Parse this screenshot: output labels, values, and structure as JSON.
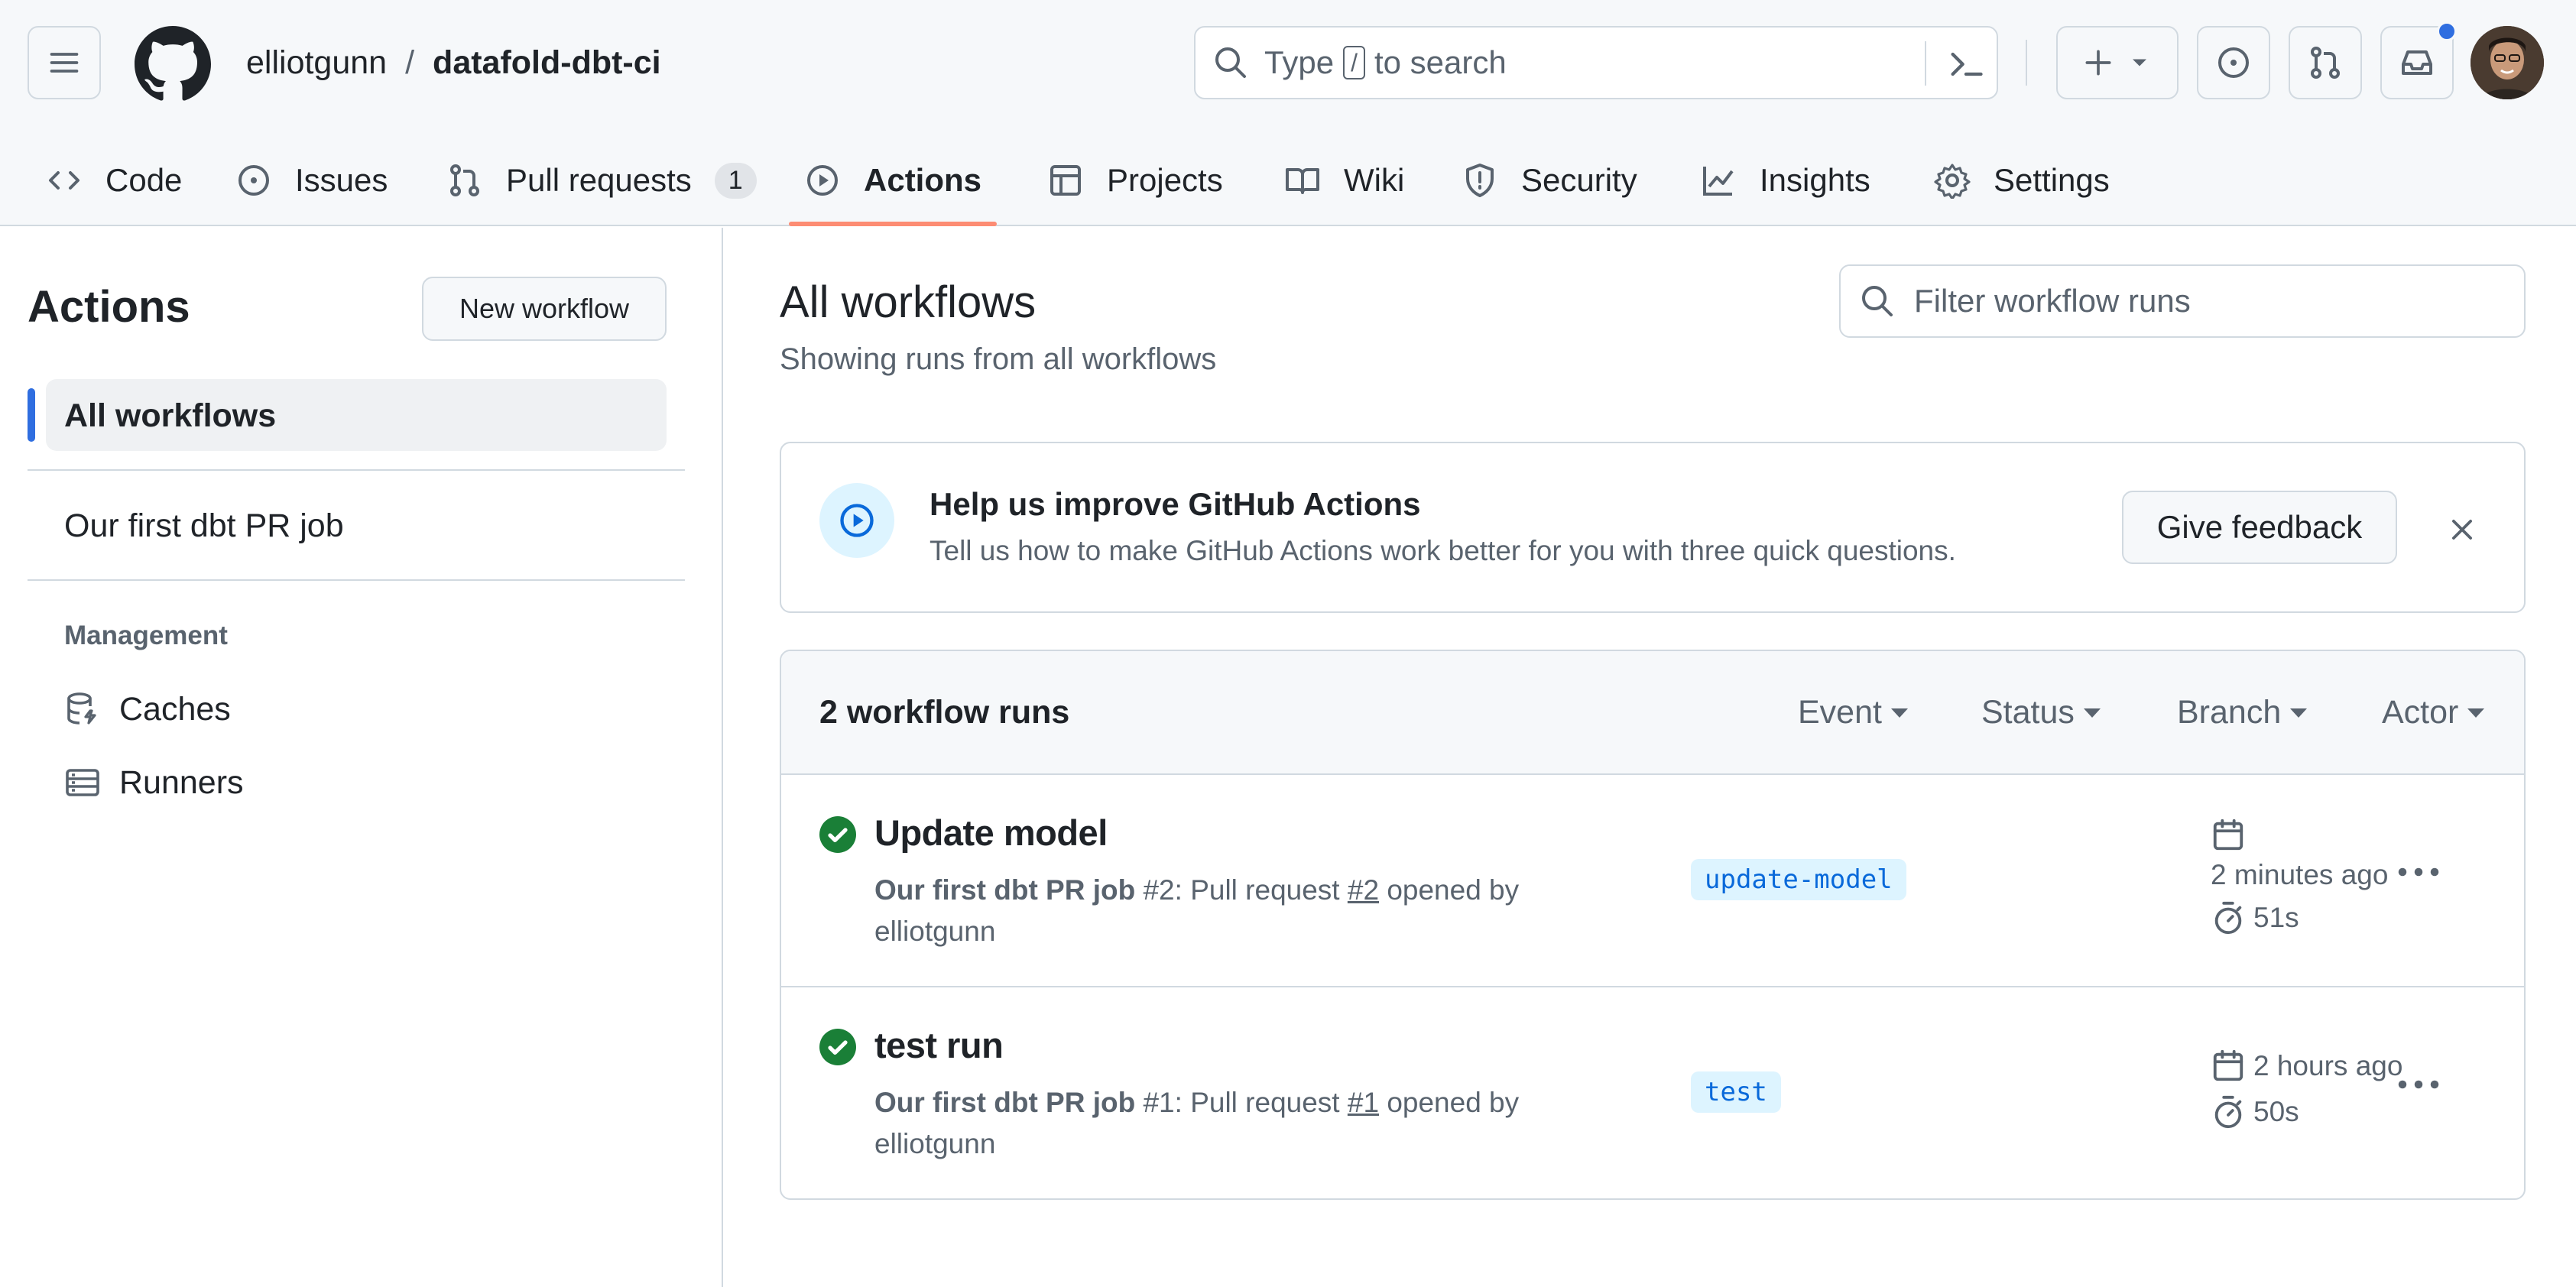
{
  "header": {
    "owner": "elliotgunn",
    "separator": "/",
    "repo": "datafold-dbt-ci",
    "search": {
      "prefix": "Type",
      "key": "/",
      "suffix": "to search"
    },
    "notification_dot_color": "#2f6ee0"
  },
  "nav": {
    "tabs": [
      {
        "label": "Code",
        "icon": "code-icon"
      },
      {
        "label": "Issues",
        "icon": "issue-icon"
      },
      {
        "label": "Pull requests",
        "icon": "pull-request-icon",
        "count": "1"
      },
      {
        "label": "Actions",
        "icon": "play-icon",
        "active": true
      },
      {
        "label": "Projects",
        "icon": "table-icon"
      },
      {
        "label": "Wiki",
        "icon": "book-icon"
      },
      {
        "label": "Security",
        "icon": "shield-icon"
      },
      {
        "label": "Insights",
        "icon": "graph-icon"
      },
      {
        "label": "Settings",
        "icon": "gear-icon"
      }
    ],
    "active_underline_color": "#fd8c73"
  },
  "sidebar": {
    "title": "Actions",
    "new_workflow_label": "New workflow",
    "workflows": [
      {
        "label": "All workflows",
        "active": true
      },
      {
        "label": "Our first dbt PR job"
      }
    ],
    "management_label": "Management",
    "management_items": [
      {
        "label": "Caches",
        "icon": "database-icon"
      },
      {
        "label": "Runners",
        "icon": "server-icon"
      }
    ]
  },
  "main": {
    "title": "All workflows",
    "subtitle": "Showing runs from all workflows",
    "filter_placeholder": "Filter workflow runs",
    "banner": {
      "title": "Help us improve GitHub Actions",
      "body": "Tell us how to make GitHub Actions work better for you with three quick questions.",
      "button": "Give feedback"
    },
    "runs": {
      "count_label": "2 workflow runs",
      "filters": [
        "Event",
        "Status",
        "Branch",
        "Actor"
      ],
      "items": [
        {
          "title": "Update model",
          "workflow": "Our first dbt PR job",
          "run_number": "#2",
          "desc_middle": ": Pull request",
          "pr_ref": "#2",
          "desc_end": "opened by",
          "author": "elliotgunn",
          "branch": "update-model",
          "time": "2 minutes ago",
          "duration": "51s",
          "status": "success"
        },
        {
          "title": "test run",
          "workflow": "Our first dbt PR job",
          "run_number": "#1",
          "desc_middle": ": Pull request",
          "pr_ref": "#1",
          "desc_end": "opened by",
          "author": "elliotgunn",
          "branch": "test",
          "time": "2 hours ago",
          "duration": "50s",
          "status": "success"
        }
      ]
    },
    "success_color": "#1a7f37"
  }
}
